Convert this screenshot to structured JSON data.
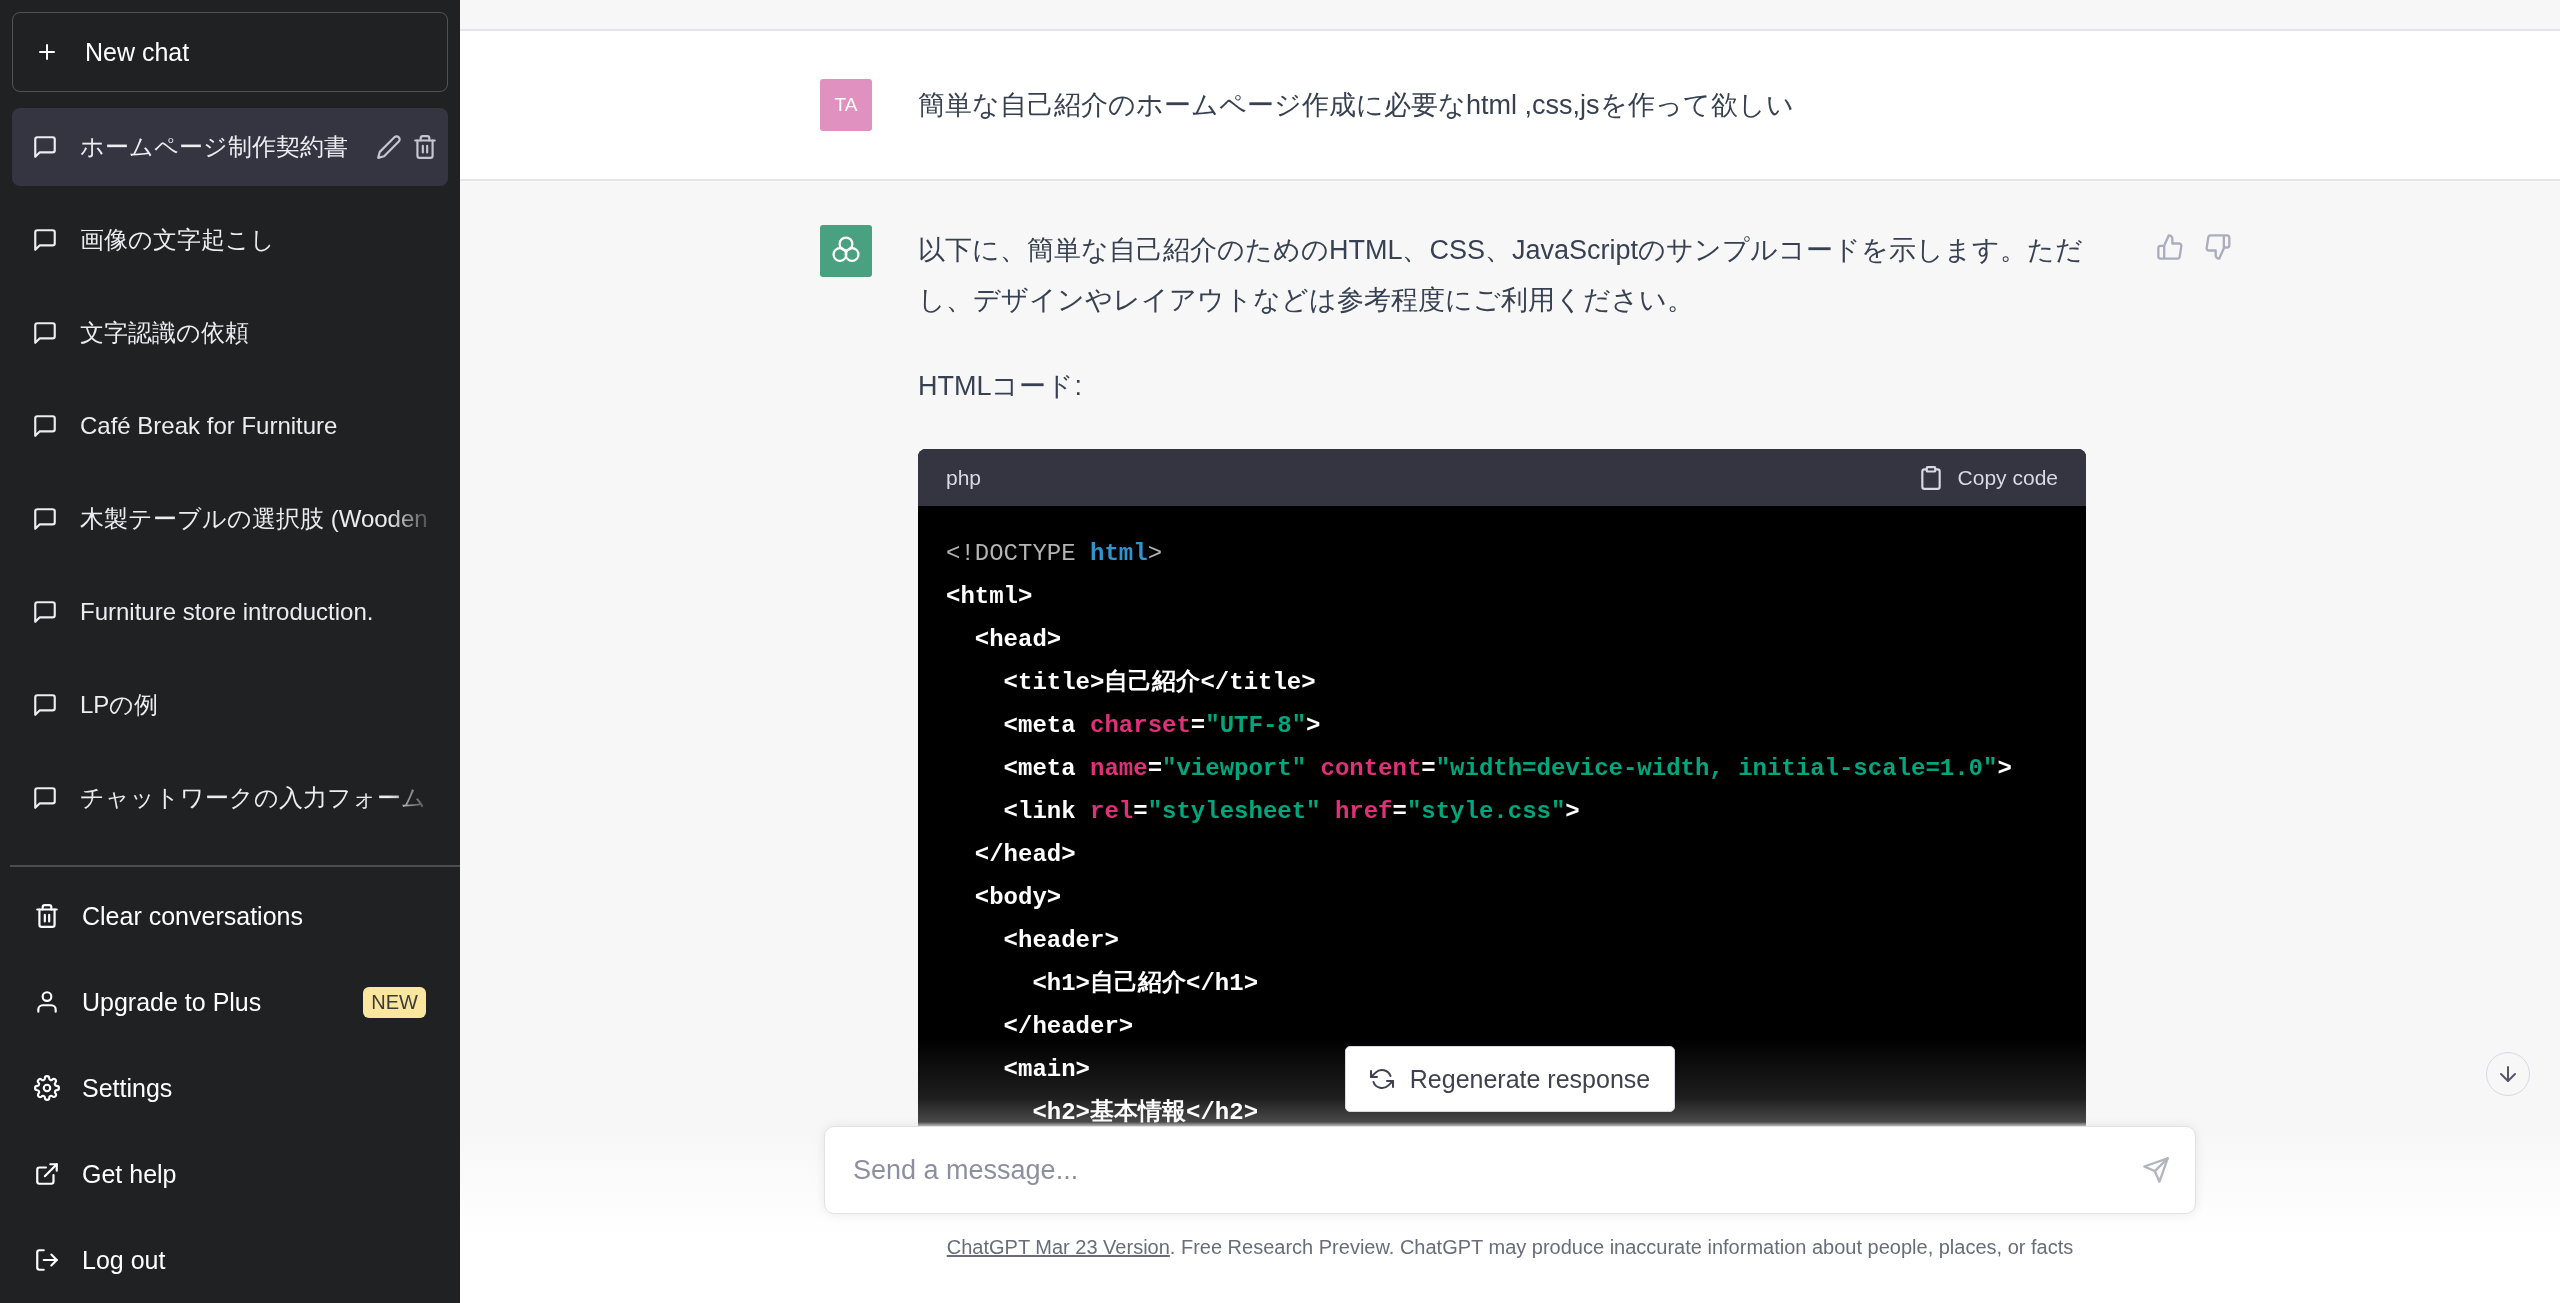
{
  "sidebar": {
    "new_chat": "New chat",
    "conversations": [
      {
        "title": "ホームページ制作契約書",
        "selected": true
      },
      {
        "title": "画像の文字起こし",
        "selected": false
      },
      {
        "title": "文字認識の依頼",
        "selected": false
      },
      {
        "title": "Café Break for Furniture",
        "selected": false
      },
      {
        "title": "木製テーブルの選択肢 (Wooden",
        "selected": false
      },
      {
        "title": "Furniture store introduction.",
        "selected": false
      },
      {
        "title": "LPの例",
        "selected": false
      },
      {
        "title": "チャットワークの入力フォーム",
        "selected": false
      }
    ],
    "menu": [
      {
        "kind": "clear",
        "label": "Clear conversations"
      },
      {
        "kind": "upgrade",
        "label": "Upgrade to Plus",
        "badge": "NEW"
      },
      {
        "kind": "settings",
        "label": "Settings"
      },
      {
        "kind": "help",
        "label": "Get help"
      },
      {
        "kind": "logout",
        "label": "Log out"
      }
    ]
  },
  "thread": [
    {
      "kind": "user",
      "avatar": "TA",
      "paragraphs": [
        "簡単な自己紹介のホームページ作成に必要なhtml ,css,jsを作って欲しい"
      ]
    },
    {
      "kind": "assistant",
      "paragraphs": [
        "以下に、簡単な自己紹介のためのHTML、CSS、JavaScriptのサンプルコードを示します。ただし、デザインやレイアウトなどは参考程度にご利用ください。",
        "HTMLコード:"
      ],
      "code": {
        "language": "php",
        "copy_label": "Copy code",
        "lines": [
          [
            {
              "t": "<!DOCTYPE ",
              "kind": "meta"
            },
            {
              "t": "html",
              "kind": "keyword"
            },
            {
              "t": ">",
              "kind": "meta"
            }
          ],
          [
            {
              "t": "<html>",
              "kind": "tag"
            }
          ],
          [
            {
              "t": "  <head>",
              "kind": "tag"
            }
          ],
          [
            {
              "t": "    <title>自己紹介</title>",
              "kind": "tag"
            }
          ],
          [
            {
              "t": "    <meta ",
              "kind": "tag"
            },
            {
              "t": "charset",
              "kind": "attr"
            },
            {
              "t": "=",
              "kind": "tag"
            },
            {
              "t": "\"UTF-8\"",
              "kind": "string"
            },
            {
              "t": ">",
              "kind": "tag"
            }
          ],
          [
            {
              "t": "    <meta ",
              "kind": "tag"
            },
            {
              "t": "name",
              "kind": "attr"
            },
            {
              "t": "=",
              "kind": "tag"
            },
            {
              "t": "\"viewport\"",
              "kind": "string"
            },
            {
              "t": " content",
              "kind": "attr"
            },
            {
              "t": "=",
              "kind": "tag"
            },
            {
              "t": "\"width=device-width, initial-scale=1.0\"",
              "kind": "string"
            },
            {
              "t": ">",
              "kind": "tag"
            }
          ],
          [
            {
              "t": "    <link ",
              "kind": "tag"
            },
            {
              "t": "rel",
              "kind": "attr"
            },
            {
              "t": "=",
              "kind": "tag"
            },
            {
              "t": "\"stylesheet\"",
              "kind": "string"
            },
            {
              "t": " href",
              "kind": "attr"
            },
            {
              "t": "=",
              "kind": "tag"
            },
            {
              "t": "\"style.css\"",
              "kind": "string"
            },
            {
              "t": ">",
              "kind": "tag"
            }
          ],
          [
            {
              "t": "  </head>",
              "kind": "tag"
            }
          ],
          [
            {
              "t": "  <body>",
              "kind": "tag"
            }
          ],
          [
            {
              "t": "    <header>",
              "kind": "tag"
            }
          ],
          [
            {
              "t": "      <h1>自己紹介</h1>",
              "kind": "tag"
            }
          ],
          [
            {
              "t": "    </header>",
              "kind": "tag"
            }
          ],
          [
            {
              "t": "    <main>",
              "kind": "tag"
            }
          ],
          [
            {
              "t": "      <h2>基本情報</h2>",
              "kind": "tag"
            }
          ]
        ]
      }
    }
  ],
  "regenerate_button": "Regenerate response",
  "composer": {
    "placeholder": "Send a message..."
  },
  "footer": {
    "link": "ChatGPT Mar 23 Version",
    "text": ". Free Research Preview. ChatGPT may produce inaccurate information about people, places, or facts"
  }
}
